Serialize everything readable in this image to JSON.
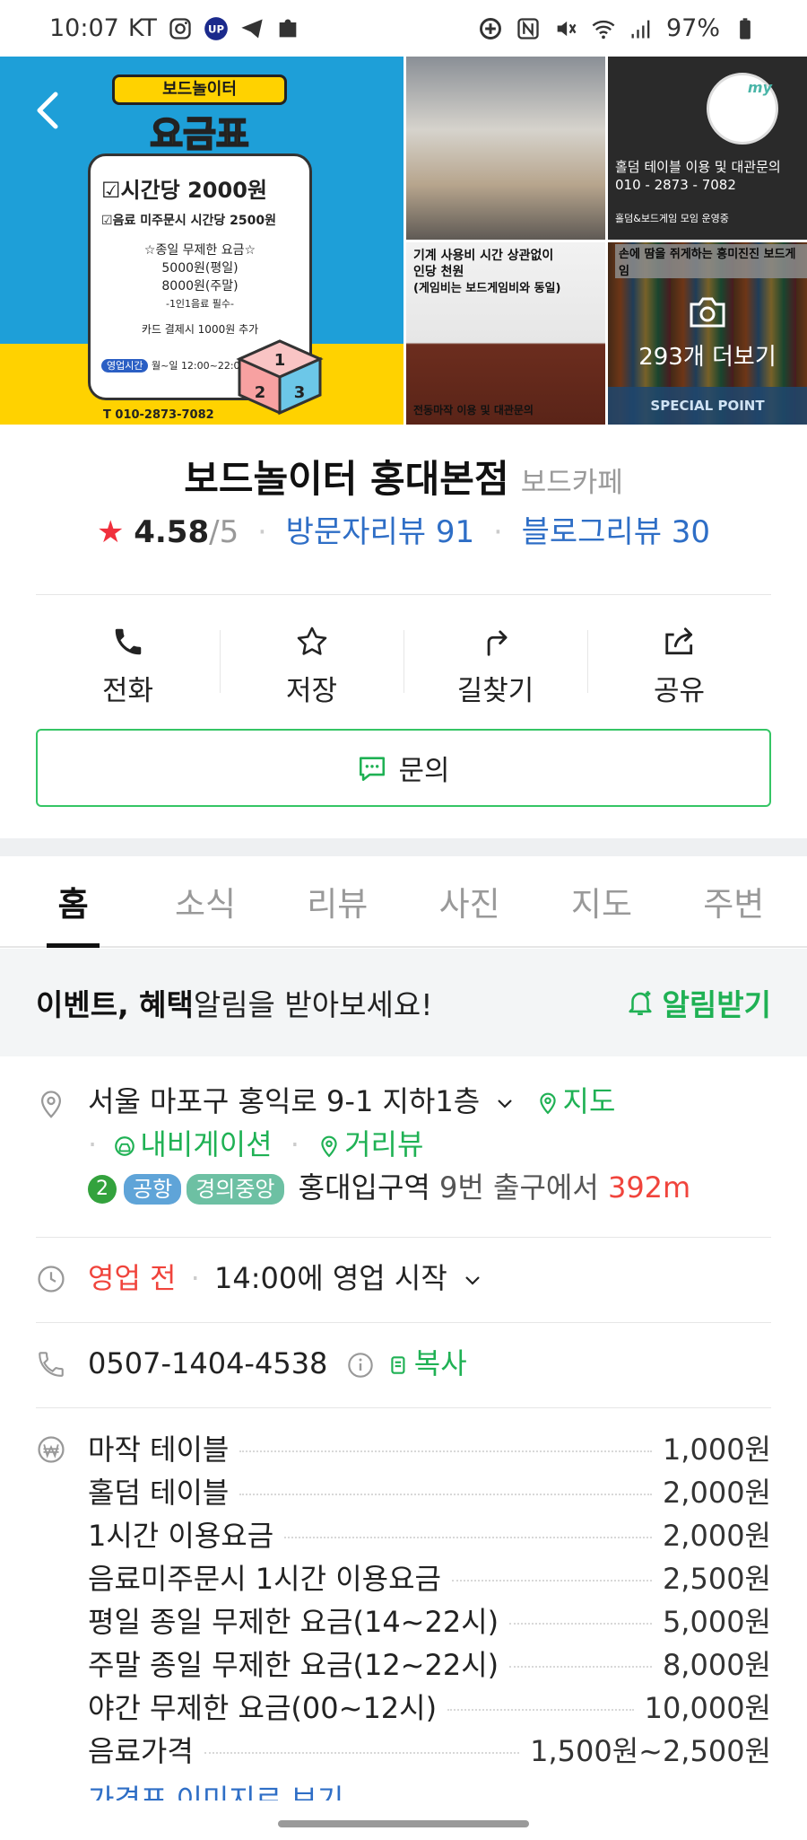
{
  "status_bar": {
    "time": "10:07",
    "carrier": "KT",
    "battery": "97%"
  },
  "gallery": {
    "poster_tag": "보드놀이터",
    "poster_title": "요금표",
    "poster_line1": "시간당 2000원",
    "poster_line2": "음료 미주문시 시간당 2500원",
    "poster_line3": "☆종일 무제한 요금☆",
    "poster_line4": "5000원(평일)",
    "poster_line5": "8000원(주말)",
    "poster_line6": "-1인1음료 필수-",
    "poster_line7": "카드 결제시 1000원 추가",
    "poster_hours_tag": "영업시간",
    "poster_hours": "월~일 12:00~22:00",
    "poster_phone": "T 010-2873-7082",
    "photo2_text1": "홀덤 테이블 이용 및 대관문의",
    "photo2_text2": "010 - 2873 - 7082",
    "photo2_text3": "홀덤&보드게임 모임 운영중",
    "photo3_text1": "기계 사용비 시간 상관없이",
    "photo3_text2": "인당 천원",
    "photo3_text3": "(게임비는 보드게임비와 동일)",
    "photo3_text4": "전동마작 이용 및 대관문의",
    "photo4_text": "손에 땀을 쥐게하는 흥미진진 보드게임",
    "more_label": "293개 더보기",
    "special_point": "SPECIAL POINT",
    "my_badge": "my"
  },
  "place": {
    "name": "보드놀이터 홍대본점",
    "category": "보드카페",
    "rating": "4.58",
    "rating_max": "/5",
    "visitor_reviews": "방문자리뷰 91",
    "blog_reviews": "블로그리뷰 30"
  },
  "actions": {
    "call": "전화",
    "save": "저장",
    "directions": "길찾기",
    "share": "공유",
    "inquiry": "문의"
  },
  "tabs": [
    "홈",
    "소식",
    "리뷰",
    "사진",
    "지도",
    "주변"
  ],
  "notice": {
    "bold": "이벤트, 혜택",
    "text": " 알림을 받아보세요!",
    "action": "알림받기"
  },
  "info": {
    "address": "서울 마포구 홍익로 9-1 지하1층",
    "map_link": "지도",
    "navigation_link": "내비게이션",
    "street_view_link": "거리뷰",
    "subway_line_number": "2",
    "subway_line_airport": "공항",
    "subway_line_gyeongui": "경의중앙",
    "station": "홍대입구역",
    "exit_text": "9번 출구에서",
    "distance": "392m",
    "status": "영업 전",
    "open_time": "14:00에 영업 시작",
    "phone": "0507-1404-4538",
    "copy": "복사",
    "price_more": "가격표 이미지로 보기"
  },
  "prices": [
    {
      "name": "마작 테이블",
      "value": "1,000원"
    },
    {
      "name": "홀덤 테이블",
      "value": "2,000원"
    },
    {
      "name": "1시간 이용요금",
      "value": "2,000원"
    },
    {
      "name": "음료미주문시 1시간 이용요금",
      "value": "2,500원"
    },
    {
      "name": "평일 종일 무제한 요금(14~22시)",
      "value": "5,000원"
    },
    {
      "name": "주말 종일 무제한 요금(12~22시)",
      "value": "8,000원"
    },
    {
      "name": "야간 무제한 요금(00~12시)",
      "value": "10,000원"
    },
    {
      "name": "음료가격",
      "value": "1,500원~2,500원"
    }
  ],
  "colors": {
    "brand_green": "#1fb154",
    "link_blue": "#2e6ec6",
    "rating_star": "#f0303d",
    "closed_red": "#f0443c"
  }
}
